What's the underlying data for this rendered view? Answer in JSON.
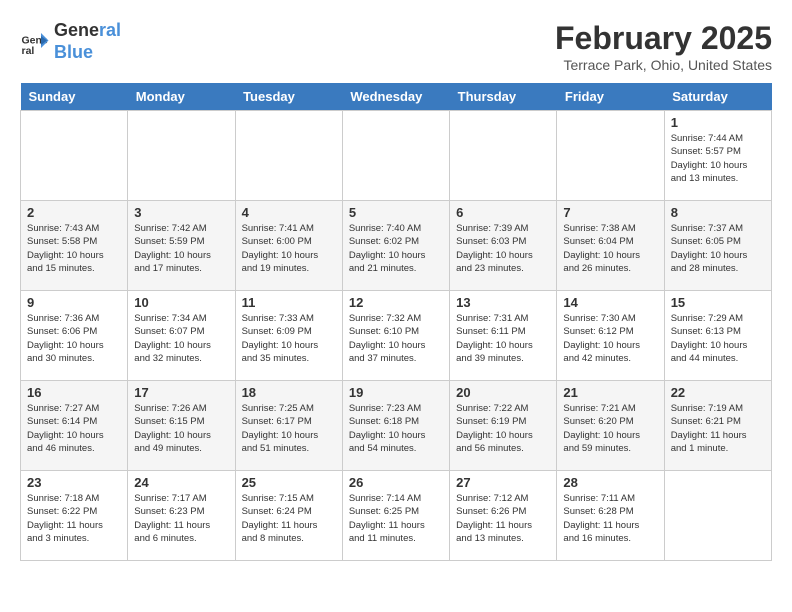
{
  "header": {
    "logo_line1": "General",
    "logo_line2": "Blue",
    "month": "February 2025",
    "location": "Terrace Park, Ohio, United States"
  },
  "days_of_week": [
    "Sunday",
    "Monday",
    "Tuesday",
    "Wednesday",
    "Thursday",
    "Friday",
    "Saturday"
  ],
  "weeks": [
    [
      {
        "day": "",
        "info": ""
      },
      {
        "day": "",
        "info": ""
      },
      {
        "day": "",
        "info": ""
      },
      {
        "day": "",
        "info": ""
      },
      {
        "day": "",
        "info": ""
      },
      {
        "day": "",
        "info": ""
      },
      {
        "day": "1",
        "info": "Sunrise: 7:44 AM\nSunset: 5:57 PM\nDaylight: 10 hours and 13 minutes."
      }
    ],
    [
      {
        "day": "2",
        "info": "Sunrise: 7:43 AM\nSunset: 5:58 PM\nDaylight: 10 hours and 15 minutes."
      },
      {
        "day": "3",
        "info": "Sunrise: 7:42 AM\nSunset: 5:59 PM\nDaylight: 10 hours and 17 minutes."
      },
      {
        "day": "4",
        "info": "Sunrise: 7:41 AM\nSunset: 6:00 PM\nDaylight: 10 hours and 19 minutes."
      },
      {
        "day": "5",
        "info": "Sunrise: 7:40 AM\nSunset: 6:02 PM\nDaylight: 10 hours and 21 minutes."
      },
      {
        "day": "6",
        "info": "Sunrise: 7:39 AM\nSunset: 6:03 PM\nDaylight: 10 hours and 23 minutes."
      },
      {
        "day": "7",
        "info": "Sunrise: 7:38 AM\nSunset: 6:04 PM\nDaylight: 10 hours and 26 minutes."
      },
      {
        "day": "8",
        "info": "Sunrise: 7:37 AM\nSunset: 6:05 PM\nDaylight: 10 hours and 28 minutes."
      }
    ],
    [
      {
        "day": "9",
        "info": "Sunrise: 7:36 AM\nSunset: 6:06 PM\nDaylight: 10 hours and 30 minutes."
      },
      {
        "day": "10",
        "info": "Sunrise: 7:34 AM\nSunset: 6:07 PM\nDaylight: 10 hours and 32 minutes."
      },
      {
        "day": "11",
        "info": "Sunrise: 7:33 AM\nSunset: 6:09 PM\nDaylight: 10 hours and 35 minutes."
      },
      {
        "day": "12",
        "info": "Sunrise: 7:32 AM\nSunset: 6:10 PM\nDaylight: 10 hours and 37 minutes."
      },
      {
        "day": "13",
        "info": "Sunrise: 7:31 AM\nSunset: 6:11 PM\nDaylight: 10 hours and 39 minutes."
      },
      {
        "day": "14",
        "info": "Sunrise: 7:30 AM\nSunset: 6:12 PM\nDaylight: 10 hours and 42 minutes."
      },
      {
        "day": "15",
        "info": "Sunrise: 7:29 AM\nSunset: 6:13 PM\nDaylight: 10 hours and 44 minutes."
      }
    ],
    [
      {
        "day": "16",
        "info": "Sunrise: 7:27 AM\nSunset: 6:14 PM\nDaylight: 10 hours and 46 minutes."
      },
      {
        "day": "17",
        "info": "Sunrise: 7:26 AM\nSunset: 6:15 PM\nDaylight: 10 hours and 49 minutes."
      },
      {
        "day": "18",
        "info": "Sunrise: 7:25 AM\nSunset: 6:17 PM\nDaylight: 10 hours and 51 minutes."
      },
      {
        "day": "19",
        "info": "Sunrise: 7:23 AM\nSunset: 6:18 PM\nDaylight: 10 hours and 54 minutes."
      },
      {
        "day": "20",
        "info": "Sunrise: 7:22 AM\nSunset: 6:19 PM\nDaylight: 10 hours and 56 minutes."
      },
      {
        "day": "21",
        "info": "Sunrise: 7:21 AM\nSunset: 6:20 PM\nDaylight: 10 hours and 59 minutes."
      },
      {
        "day": "22",
        "info": "Sunrise: 7:19 AM\nSunset: 6:21 PM\nDaylight: 11 hours and 1 minute."
      }
    ],
    [
      {
        "day": "23",
        "info": "Sunrise: 7:18 AM\nSunset: 6:22 PM\nDaylight: 11 hours and 3 minutes."
      },
      {
        "day": "24",
        "info": "Sunrise: 7:17 AM\nSunset: 6:23 PM\nDaylight: 11 hours and 6 minutes."
      },
      {
        "day": "25",
        "info": "Sunrise: 7:15 AM\nSunset: 6:24 PM\nDaylight: 11 hours and 8 minutes."
      },
      {
        "day": "26",
        "info": "Sunrise: 7:14 AM\nSunset: 6:25 PM\nDaylight: 11 hours and 11 minutes."
      },
      {
        "day": "27",
        "info": "Sunrise: 7:12 AM\nSunset: 6:26 PM\nDaylight: 11 hours and 13 minutes."
      },
      {
        "day": "28",
        "info": "Sunrise: 7:11 AM\nSunset: 6:28 PM\nDaylight: 11 hours and 16 minutes."
      },
      {
        "day": "",
        "info": ""
      }
    ]
  ]
}
